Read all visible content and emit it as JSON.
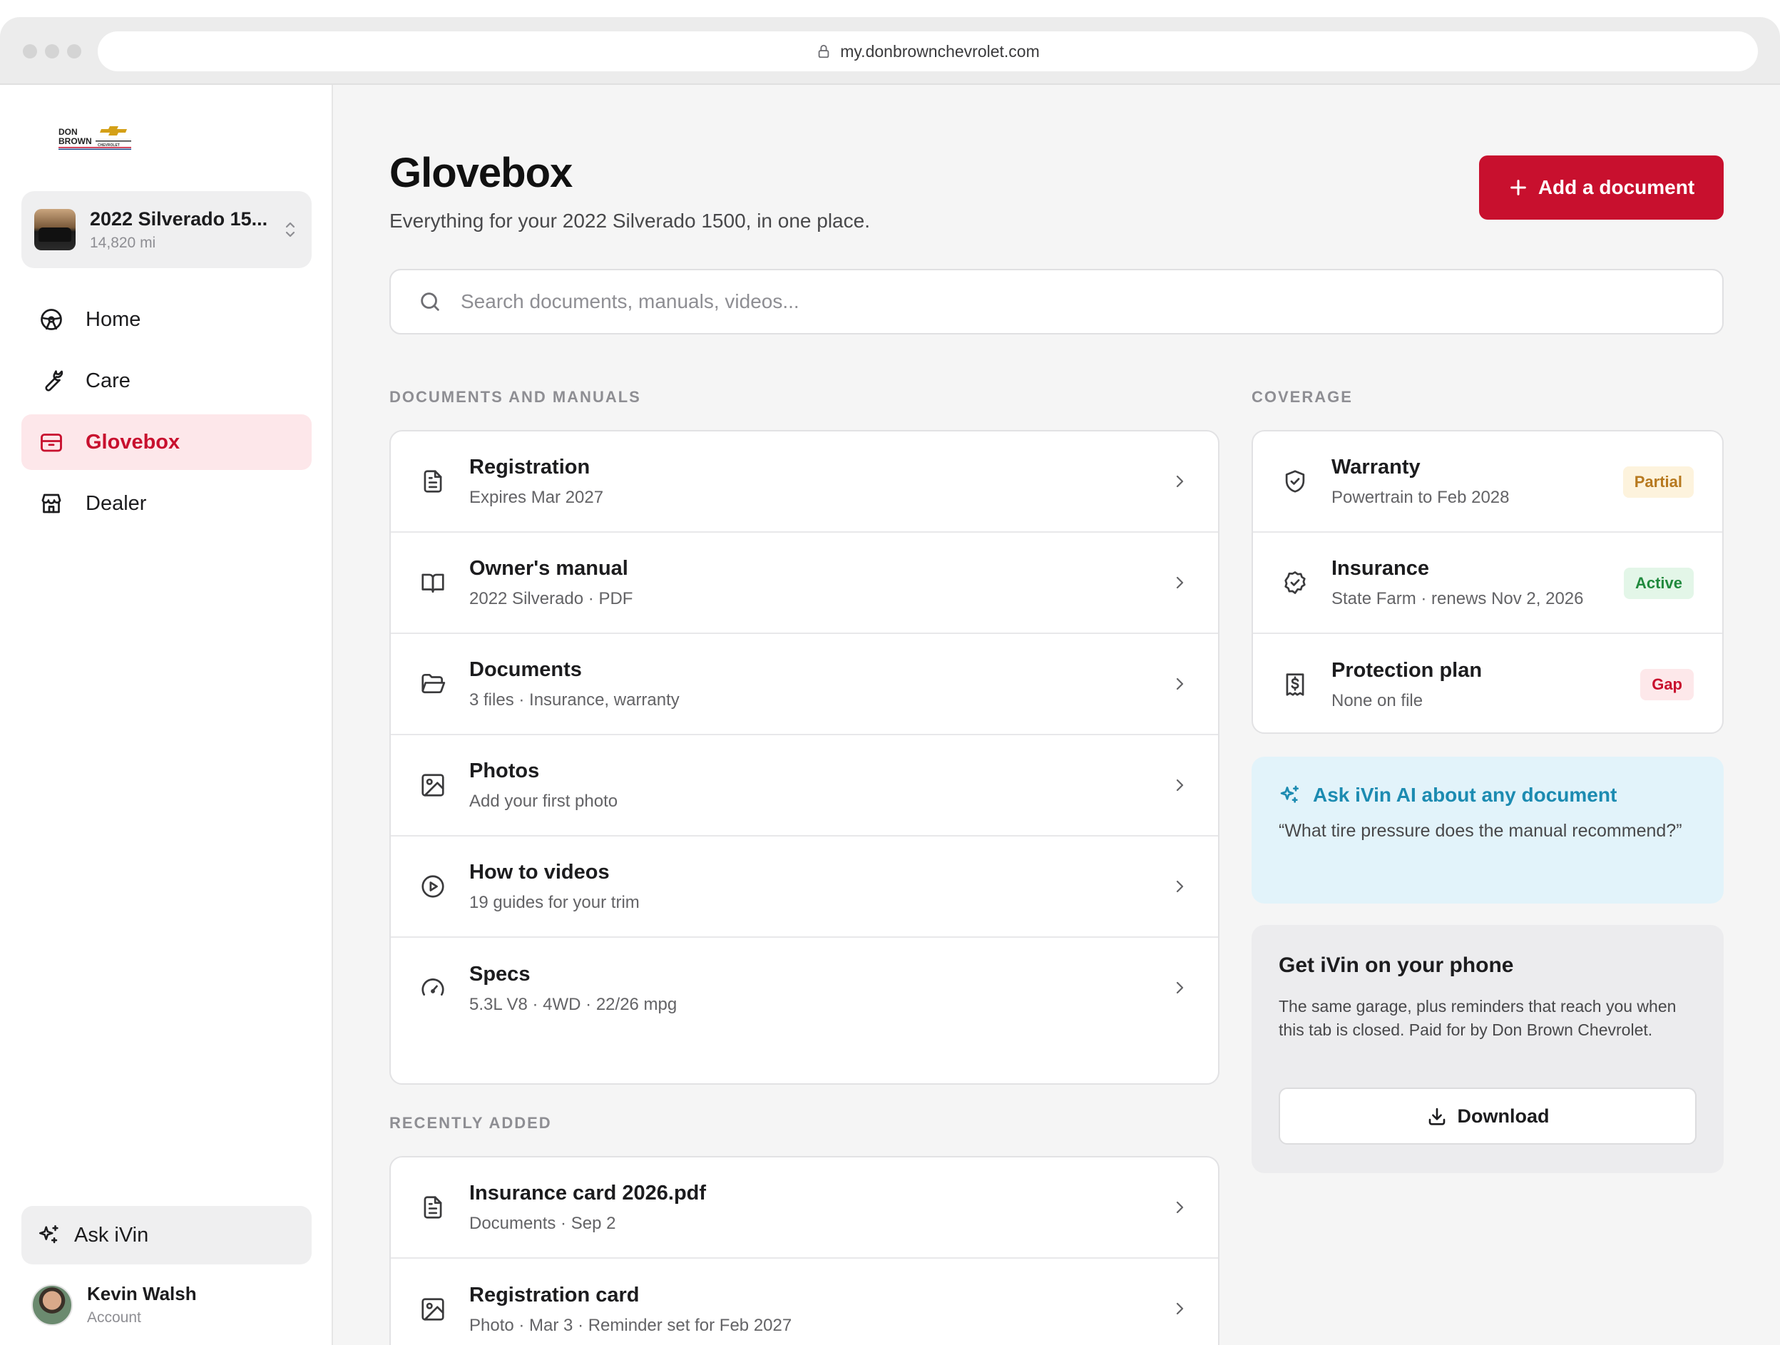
{
  "browser": {
    "url": "my.donbrownchevrolet.com"
  },
  "sidebar": {
    "logo_alt": "DON BROWN CHEVROLET",
    "vehicle": {
      "name": "2022 Silverado 15...",
      "mileage": "14,820 mi"
    },
    "nav": [
      {
        "label": "Home",
        "icon": "steering-wheel-icon",
        "active": false
      },
      {
        "label": "Care",
        "icon": "wrench-icon",
        "active": false
      },
      {
        "label": "Glovebox",
        "icon": "inbox-icon",
        "active": true
      },
      {
        "label": "Dealer",
        "icon": "store-icon",
        "active": false
      }
    ],
    "ask_label": "Ask iVin",
    "user": {
      "name": "Kevin Walsh",
      "sub": "Account"
    }
  },
  "header": {
    "title": "Glovebox",
    "subtitle": "Everything for your 2022 Silverado 1500, in one place.",
    "add_button": "Add a document"
  },
  "search": {
    "placeholder": "Search documents, manuals, videos..."
  },
  "documents": {
    "label": "DOCUMENTS AND MANUALS",
    "items": [
      {
        "title": "Registration",
        "sub": "Expires Mar 2027",
        "icon": "file-text-icon"
      },
      {
        "title": "Owner's manual",
        "sub": "2022 Silverado · PDF",
        "icon": "book-icon"
      },
      {
        "title": "Documents",
        "sub": "3 files · Insurance, warranty",
        "icon": "folder-icon"
      },
      {
        "title": "Photos",
        "sub": "Add your first photo",
        "icon": "image-icon"
      },
      {
        "title": "How to videos",
        "sub": "19 guides for your trim",
        "icon": "play-circle-icon"
      },
      {
        "title": "Specs",
        "sub": "5.3L V8 · 4WD · 22/26 mpg",
        "icon": "gauge-icon"
      }
    ]
  },
  "recent": {
    "label": "RECENTLY ADDED",
    "items": [
      {
        "title": "Insurance card 2026.pdf",
        "sub": "Documents · Sep 2",
        "icon": "file-text-icon"
      },
      {
        "title": "Registration card",
        "sub": "Photo · Mar 3 · Reminder set for Feb 2027",
        "icon": "image-icon"
      }
    ]
  },
  "coverage": {
    "label": "COVERAGE",
    "items": [
      {
        "title": "Warranty",
        "sub": "Powertrain to Feb 2028",
        "badge": "Partial",
        "icon": "shield-check-icon"
      },
      {
        "title": "Insurance",
        "sub": "State Farm · renews Nov 2, 2026",
        "badge": "Active",
        "icon": "badge-check-icon"
      },
      {
        "title": "Protection plan",
        "sub": "None on file",
        "badge": "Gap",
        "icon": "receipt-dollar-icon"
      }
    ]
  },
  "ai_card": {
    "title": "Ask iVin AI about any document",
    "quote": "“What tire pressure does the manual recommend?”"
  },
  "phone_card": {
    "title": "Get iVin on your phone",
    "body": "The same garage, plus reminders that reach you when this tab is closed. Paid for by Don Brown Chevrolet.",
    "button": "Download"
  },
  "colors": {
    "brand_red": "#c8102e",
    "ai_blue": "#1c8bb1",
    "page_bg": "#f5f5f5"
  }
}
